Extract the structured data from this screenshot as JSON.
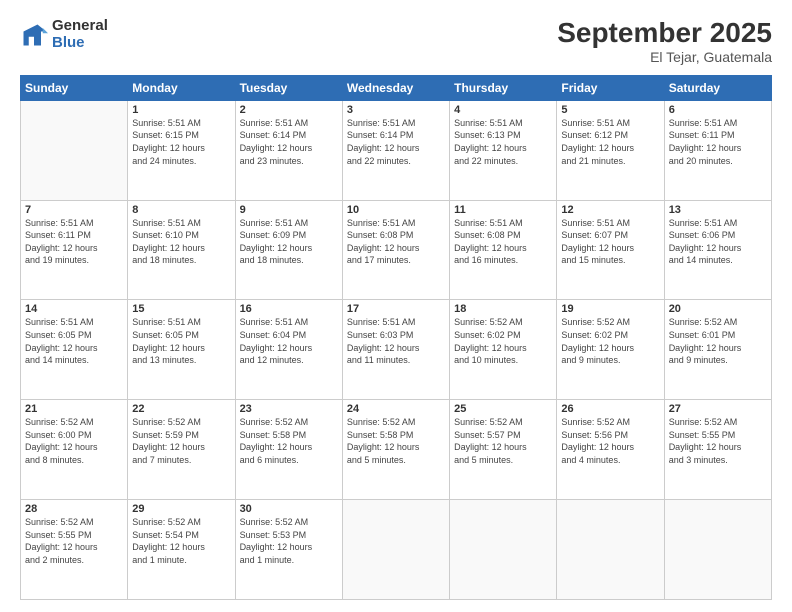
{
  "logo": {
    "general": "General",
    "blue": "Blue"
  },
  "title": "September 2025",
  "subtitle": "El Tejar, Guatemala",
  "days_header": [
    "Sunday",
    "Monday",
    "Tuesday",
    "Wednesday",
    "Thursday",
    "Friday",
    "Saturday"
  ],
  "weeks": [
    [
      {
        "num": "",
        "info": ""
      },
      {
        "num": "1",
        "info": "Sunrise: 5:51 AM\nSunset: 6:15 PM\nDaylight: 12 hours\nand 24 minutes."
      },
      {
        "num": "2",
        "info": "Sunrise: 5:51 AM\nSunset: 6:14 PM\nDaylight: 12 hours\nand 23 minutes."
      },
      {
        "num": "3",
        "info": "Sunrise: 5:51 AM\nSunset: 6:14 PM\nDaylight: 12 hours\nand 22 minutes."
      },
      {
        "num": "4",
        "info": "Sunrise: 5:51 AM\nSunset: 6:13 PM\nDaylight: 12 hours\nand 22 minutes."
      },
      {
        "num": "5",
        "info": "Sunrise: 5:51 AM\nSunset: 6:12 PM\nDaylight: 12 hours\nand 21 minutes."
      },
      {
        "num": "6",
        "info": "Sunrise: 5:51 AM\nSunset: 6:11 PM\nDaylight: 12 hours\nand 20 minutes."
      }
    ],
    [
      {
        "num": "7",
        "info": "Sunrise: 5:51 AM\nSunset: 6:11 PM\nDaylight: 12 hours\nand 19 minutes."
      },
      {
        "num": "8",
        "info": "Sunrise: 5:51 AM\nSunset: 6:10 PM\nDaylight: 12 hours\nand 18 minutes."
      },
      {
        "num": "9",
        "info": "Sunrise: 5:51 AM\nSunset: 6:09 PM\nDaylight: 12 hours\nand 18 minutes."
      },
      {
        "num": "10",
        "info": "Sunrise: 5:51 AM\nSunset: 6:08 PM\nDaylight: 12 hours\nand 17 minutes."
      },
      {
        "num": "11",
        "info": "Sunrise: 5:51 AM\nSunset: 6:08 PM\nDaylight: 12 hours\nand 16 minutes."
      },
      {
        "num": "12",
        "info": "Sunrise: 5:51 AM\nSunset: 6:07 PM\nDaylight: 12 hours\nand 15 minutes."
      },
      {
        "num": "13",
        "info": "Sunrise: 5:51 AM\nSunset: 6:06 PM\nDaylight: 12 hours\nand 14 minutes."
      }
    ],
    [
      {
        "num": "14",
        "info": "Sunrise: 5:51 AM\nSunset: 6:05 PM\nDaylight: 12 hours\nand 14 minutes."
      },
      {
        "num": "15",
        "info": "Sunrise: 5:51 AM\nSunset: 6:05 PM\nDaylight: 12 hours\nand 13 minutes."
      },
      {
        "num": "16",
        "info": "Sunrise: 5:51 AM\nSunset: 6:04 PM\nDaylight: 12 hours\nand 12 minutes."
      },
      {
        "num": "17",
        "info": "Sunrise: 5:51 AM\nSunset: 6:03 PM\nDaylight: 12 hours\nand 11 minutes."
      },
      {
        "num": "18",
        "info": "Sunrise: 5:52 AM\nSunset: 6:02 PM\nDaylight: 12 hours\nand 10 minutes."
      },
      {
        "num": "19",
        "info": "Sunrise: 5:52 AM\nSunset: 6:02 PM\nDaylight: 12 hours\nand 9 minutes."
      },
      {
        "num": "20",
        "info": "Sunrise: 5:52 AM\nSunset: 6:01 PM\nDaylight: 12 hours\nand 9 minutes."
      }
    ],
    [
      {
        "num": "21",
        "info": "Sunrise: 5:52 AM\nSunset: 6:00 PM\nDaylight: 12 hours\nand 8 minutes."
      },
      {
        "num": "22",
        "info": "Sunrise: 5:52 AM\nSunset: 5:59 PM\nDaylight: 12 hours\nand 7 minutes."
      },
      {
        "num": "23",
        "info": "Sunrise: 5:52 AM\nSunset: 5:58 PM\nDaylight: 12 hours\nand 6 minutes."
      },
      {
        "num": "24",
        "info": "Sunrise: 5:52 AM\nSunset: 5:58 PM\nDaylight: 12 hours\nand 5 minutes."
      },
      {
        "num": "25",
        "info": "Sunrise: 5:52 AM\nSunset: 5:57 PM\nDaylight: 12 hours\nand 5 minutes."
      },
      {
        "num": "26",
        "info": "Sunrise: 5:52 AM\nSunset: 5:56 PM\nDaylight: 12 hours\nand 4 minutes."
      },
      {
        "num": "27",
        "info": "Sunrise: 5:52 AM\nSunset: 5:55 PM\nDaylight: 12 hours\nand 3 minutes."
      }
    ],
    [
      {
        "num": "28",
        "info": "Sunrise: 5:52 AM\nSunset: 5:55 PM\nDaylight: 12 hours\nand 2 minutes."
      },
      {
        "num": "29",
        "info": "Sunrise: 5:52 AM\nSunset: 5:54 PM\nDaylight: 12 hours\nand 1 minute."
      },
      {
        "num": "30",
        "info": "Sunrise: 5:52 AM\nSunset: 5:53 PM\nDaylight: 12 hours\nand 1 minute."
      },
      {
        "num": "",
        "info": ""
      },
      {
        "num": "",
        "info": ""
      },
      {
        "num": "",
        "info": ""
      },
      {
        "num": "",
        "info": ""
      }
    ]
  ]
}
